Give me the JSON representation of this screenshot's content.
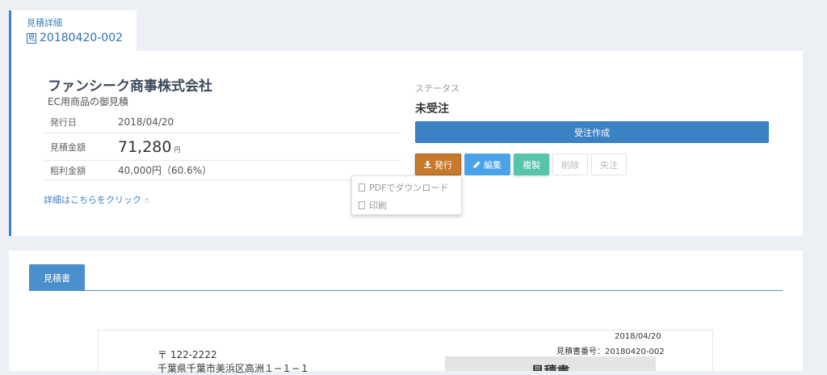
{
  "header": {
    "subtitle": "見積詳細",
    "doc_icon": "見",
    "estimate_id": "20180420-002"
  },
  "summary": {
    "company": "ファンシーク商事株式会社",
    "subject": "EC用商品の御見積",
    "rows": [
      {
        "label": "発行日",
        "value": "2018/04/20"
      },
      {
        "label": "見積金額",
        "value": "71,280",
        "unit": "円"
      },
      {
        "label": "粗利金額",
        "value": "40,000円（60.6%）"
      }
    ],
    "detail_link": "詳細はこちらをクリック",
    "detail_link_icon": "☝"
  },
  "status": {
    "label": "ステータス",
    "value": "未受注"
  },
  "actions": {
    "create_order": "受注作成",
    "issue": "発行",
    "edit": "編集",
    "copy": "複製",
    "delete": "削除",
    "lost": "失注"
  },
  "dropdown": {
    "items": [
      "PDFでダウンロード",
      "印刷"
    ]
  },
  "document": {
    "tab": "見積書",
    "date": "2018/04/20",
    "number": "見積書番号：20180420-002",
    "zip": "〒 122-2222",
    "address": "千葉県千葉市美浜区高洲１−１−１",
    "title": "見積書"
  },
  "colors": {
    "accent": "#3b82c4",
    "issue": "#c67a2c",
    "edit": "#4aa3e8",
    "copy": "#56c4a8"
  }
}
